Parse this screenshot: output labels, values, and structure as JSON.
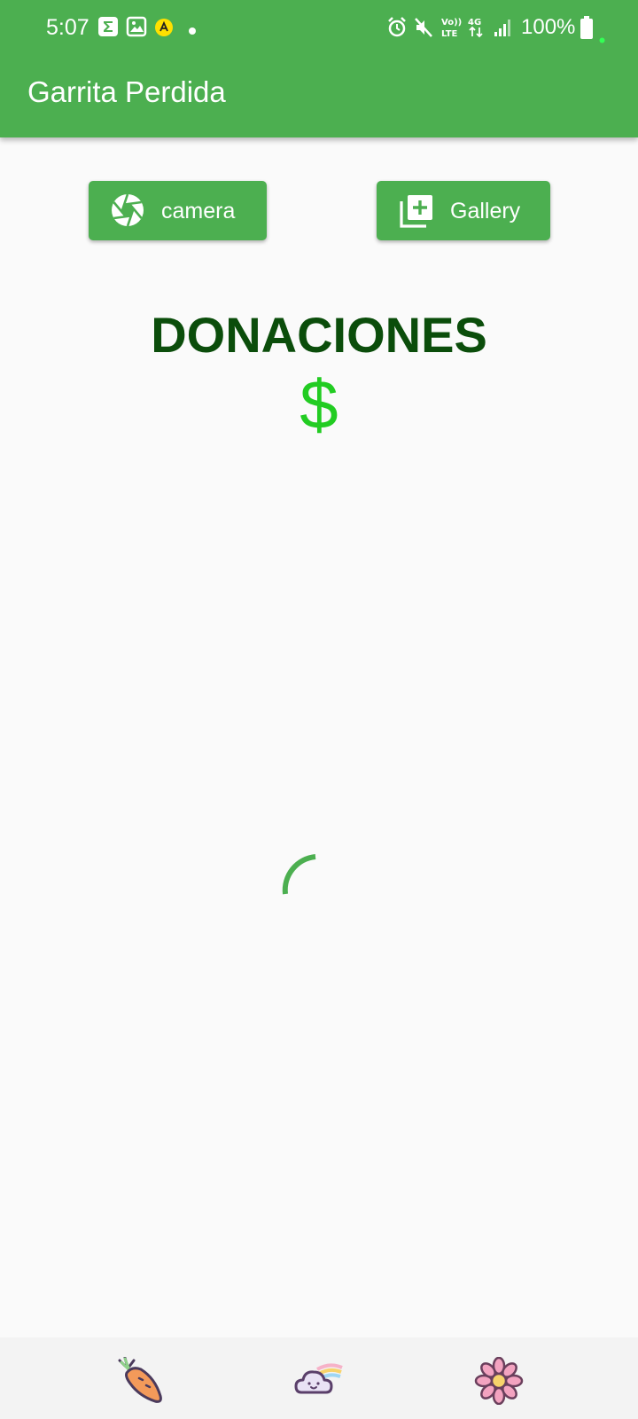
{
  "status_bar": {
    "time": "5:07",
    "battery": "100%"
  },
  "app_bar": {
    "title": "Garrita Perdida"
  },
  "actions": {
    "camera_label": "camera",
    "gallery_label": "Gallery"
  },
  "content": {
    "heading": "DONACIONES",
    "currency_symbol": "$"
  },
  "colors": {
    "primary": "#4caf50",
    "heading": "#0b4d0b",
    "dollar": "#22cc22",
    "background": "#fafafa"
  },
  "bottom_nav": {
    "items": [
      {
        "icon": "carrot-icon"
      },
      {
        "icon": "cloud-rainbow-icon"
      },
      {
        "icon": "flower-icon"
      }
    ]
  }
}
